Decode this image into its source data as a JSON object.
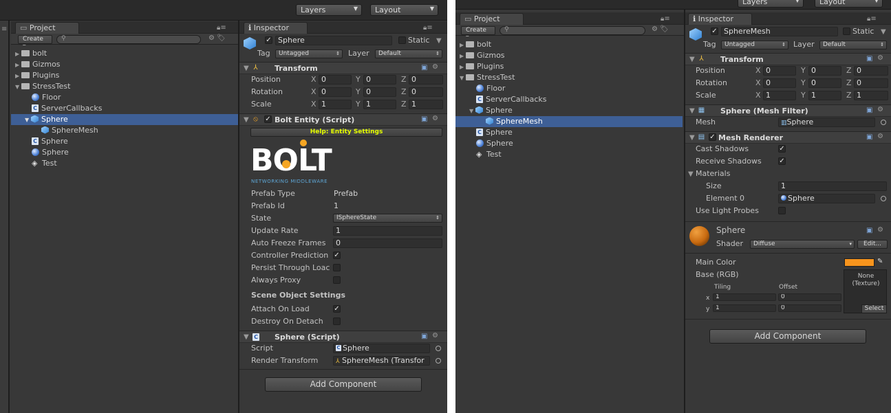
{
  "left": {
    "toolbar": {
      "layers": "Layers",
      "layout": "Layout"
    },
    "project": {
      "tab": "Project",
      "create": "Create",
      "create_arrow": "▾",
      "tree": [
        {
          "label": "bolt"
        },
        {
          "label": "Gizmos"
        },
        {
          "label": "Plugins"
        },
        {
          "label": "StressTest"
        },
        {
          "label": "Floor"
        },
        {
          "label": "ServerCallbacks"
        },
        {
          "label": "Sphere"
        },
        {
          "label": "SphereMesh"
        },
        {
          "label": "Sphere"
        },
        {
          "label": "Sphere"
        },
        {
          "label": "Test"
        }
      ]
    },
    "inspector": {
      "tab": "Inspector",
      "name": "Sphere",
      "static": "Static",
      "tag_label": "Tag",
      "tag_value": "Untagged",
      "layer_label": "Layer",
      "layer_value": "Default",
      "transform": {
        "title": "Transform",
        "position": "Position",
        "rotation": "Rotation",
        "scale": "Scale",
        "x": "X",
        "y": "Y",
        "z": "Z",
        "pos": [
          "0",
          "0",
          "0"
        ],
        "rot": [
          "0",
          "0",
          "0"
        ],
        "scl": [
          "1",
          "1",
          "1"
        ]
      },
      "bolt": {
        "title": "Bolt Entity (Script)",
        "help": "Help: Entity Settings",
        "logo": "BOLT",
        "logo_sub": "NETWORKING MIDDLEWARE",
        "prefab_type_label": "Prefab Type",
        "prefab_type": "Prefab",
        "prefab_id_label": "Prefab Id",
        "prefab_id": "1",
        "state_label": "State",
        "state": "ISphereState",
        "update_rate_label": "Update Rate",
        "update_rate": "1",
        "auto_freeze_label": "Auto Freeze Frames",
        "auto_freeze": "0",
        "controller_label": "Controller Prediction",
        "persist_label": "Persist Through Loac",
        "always_proxy_label": "Always Proxy",
        "scene_settings": "Scene Object Settings",
        "attach_label": "Attach On Load",
        "destroy_label": "Destroy On Detach"
      },
      "sphere_script": {
        "title": "Sphere (Script)",
        "script_label": "Script",
        "script": "Sphere",
        "render_label": "Render Transform",
        "render": "SphereMesh (Transfor"
      },
      "add_component": "Add Component"
    }
  },
  "right": {
    "toolbar": {
      "layers": "Layers",
      "layout": "Layout"
    },
    "project": {
      "tab": "Project",
      "create": "Create",
      "create_arrow": "▾",
      "tree": [
        {
          "label": "bolt"
        },
        {
          "label": "Gizmos"
        },
        {
          "label": "Plugins"
        },
        {
          "label": "StressTest"
        },
        {
          "label": "Floor"
        },
        {
          "label": "ServerCallbacks"
        },
        {
          "label": "Sphere"
        },
        {
          "label": "SphereMesh"
        },
        {
          "label": "Sphere"
        },
        {
          "label": "Sphere"
        },
        {
          "label": "Test"
        }
      ]
    },
    "inspector": {
      "tab": "Inspector",
      "name": "SphereMesh",
      "static": "Static",
      "tag_label": "Tag",
      "tag_value": "Untagged",
      "layer_label": "Layer",
      "layer_value": "Default",
      "transform": {
        "title": "Transform",
        "position": "Position",
        "rotation": "Rotation",
        "scale": "Scale",
        "x": "X",
        "y": "Y",
        "z": "Z",
        "pos": [
          "0",
          "0",
          "0"
        ],
        "rot": [
          "0",
          "0",
          "0"
        ],
        "scl": [
          "1",
          "1",
          "1"
        ]
      },
      "mesh_filter": {
        "title": "Sphere (Mesh Filter)",
        "mesh_label": "Mesh",
        "mesh": "Sphere"
      },
      "mesh_renderer": {
        "title": "Mesh Renderer",
        "cast_label": "Cast Shadows",
        "receive_label": "Receive Shadows",
        "materials_label": "Materials",
        "size_label": "Size",
        "size": "1",
        "element_label": "Element 0",
        "element": "Sphere",
        "light_probes_label": "Use Light Probes"
      },
      "material": {
        "name": "Sphere",
        "shader_label": "Shader",
        "shader": "Diffuse",
        "edit": "Edit...",
        "main_color_label": "Main Color",
        "main_color": "#f7941d",
        "base_label": "Base (RGB)",
        "none_texture": "None\n(Texture)",
        "select": "Select",
        "tiling": "Tiling",
        "offset": "Offset",
        "tx": "1",
        "ox": "0",
        "ty": "1",
        "oy": "0",
        "x": "x",
        "y": "y"
      },
      "add_component": "Add Component"
    }
  }
}
